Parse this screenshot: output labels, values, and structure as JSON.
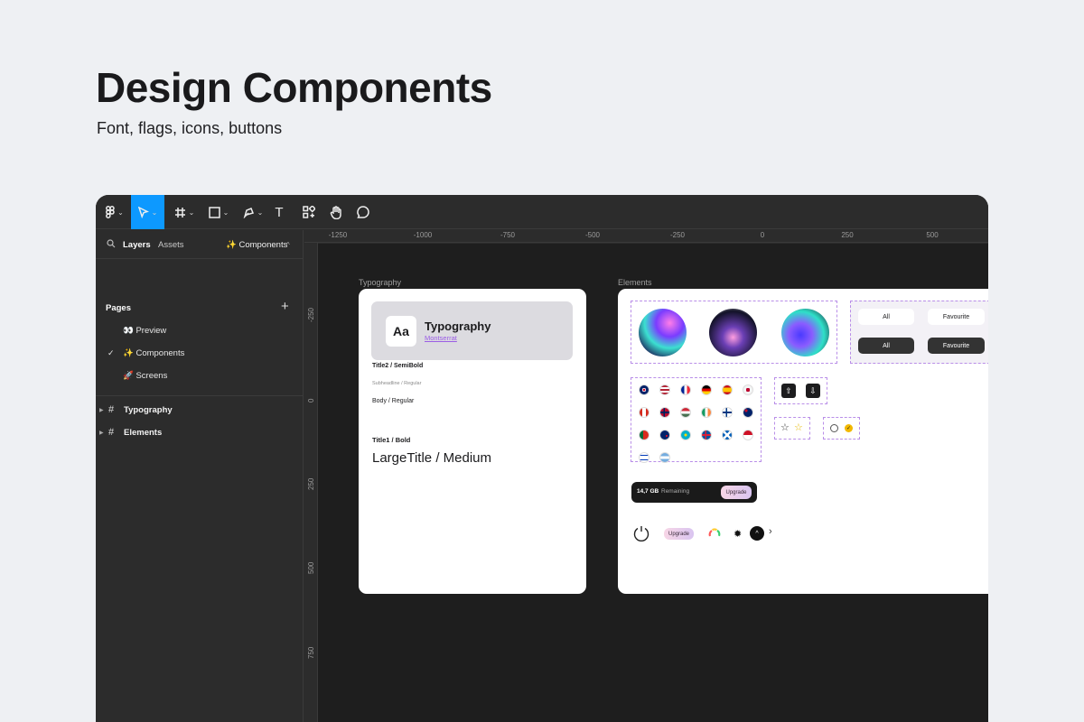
{
  "hero": {
    "title": "Design Components",
    "subtitle": "Font, flags, icons, buttons"
  },
  "toolbar": {
    "tools": [
      "figma-menu",
      "move",
      "frame",
      "shape",
      "pen",
      "text",
      "components",
      "hand",
      "comment"
    ],
    "text_tool": "T",
    "active": "move",
    "accent": "#0d99ff"
  },
  "sidebar": {
    "tabs": {
      "layers": "Layers",
      "assets": "Assets",
      "page": "✨ Components",
      "page_chevron": "^"
    },
    "pages_header": "Pages",
    "add": "+",
    "pages": [
      {
        "label": "👀 Preview",
        "current": false
      },
      {
        "label": "✨ Components",
        "current": true,
        "check": "✓"
      },
      {
        "label": "🚀 Screens",
        "current": false
      }
    ],
    "layers": [
      {
        "label": "Typography",
        "caret": "▶",
        "hash": "#"
      },
      {
        "label": "Elements",
        "caret": "▶",
        "hash": "#"
      }
    ]
  },
  "ruler": {
    "top": [
      "-1250",
      "-1000",
      "-750",
      "-500",
      "-250",
      "0",
      "250",
      "500"
    ],
    "left": [
      "-250",
      "0",
      "250",
      "500",
      "750"
    ]
  },
  "canvas": {
    "typography": {
      "label": "Typography",
      "aa": "Aa",
      "title": "Typography",
      "font": "Montserrat",
      "styles": {
        "title2": "Title2 / SemiBold",
        "subheadline": "Subheadline / Regular",
        "body": "Body / Regular",
        "title1": "Title1 / Bold",
        "large": "LargeTitle / Medium"
      }
    },
    "elements": {
      "label": "Elements",
      "buttons": {
        "all": "All",
        "favourite": "Favourite"
      },
      "storage": {
        "size": "14,7 GB",
        "text": "Remaining",
        "button": "Upgrade"
      },
      "upgrade": "Upgrade",
      "flags": [
        "gb",
        "us",
        "fr",
        "de",
        "es",
        "jp",
        "ca",
        "no",
        "hu",
        "ie",
        "fi",
        "au",
        "pt",
        "nz",
        "kz",
        "is",
        "sc",
        "id",
        "il",
        "ar"
      ],
      "icons": {
        "upload": "upload-icon",
        "download": "download-icon",
        "star": "star-icon",
        "radio": "radio-icon",
        "chevron": "›"
      }
    }
  }
}
